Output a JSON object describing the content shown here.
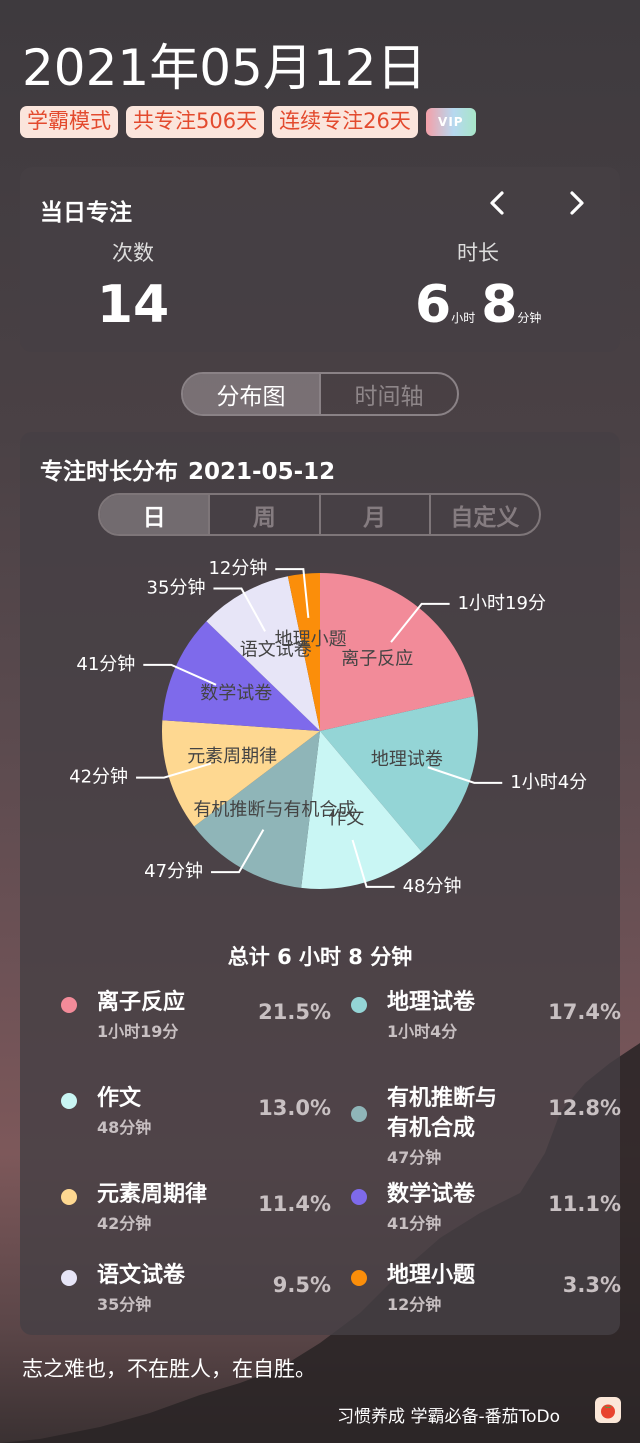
{
  "date_title": "2021年05月12日",
  "badges": [
    "学霸模式",
    "共专注506天",
    "连续专注26天"
  ],
  "vip_label": "VIP",
  "day_card": {
    "title": "当日专注",
    "count_label": "次数",
    "count_value": "14",
    "duration_label": "时长",
    "duration_hours": "6",
    "hours_unit": "小时",
    "duration_minutes": "8",
    "minutes_unit": "分钟"
  },
  "view_tabs": [
    "分布图",
    "时间轴"
  ],
  "distribution": {
    "title": "专注时长分布",
    "date": "2021-05-12",
    "range_tabs": [
      "日",
      "周",
      "月",
      "自定义"
    ],
    "total": "总计 6 小时 8 分钟"
  },
  "chart_data": {
    "type": "pie",
    "title": "专注时长分布",
    "unit": "minutes",
    "slices": [
      {
        "label": "离子反应",
        "value": 79,
        "duration_label": "1小时19分",
        "legend_duration": "1小时19分",
        "percent": "21.5%",
        "color": "#f28b99"
      },
      {
        "label": "地理试卷",
        "value": 64,
        "duration_label": "1小时4分",
        "legend_duration": "1小时4分",
        "percent": "17.4%",
        "color": "#94d5d6"
      },
      {
        "label": "作文",
        "value": 48,
        "duration_label": "48分钟",
        "legend_duration": "48分钟",
        "percent": "13.0%",
        "color": "#c9f6f4"
      },
      {
        "label": "有机推断与有机合成",
        "legend_label": "有机推断与\n有机合成",
        "value": 47,
        "duration_label": "47分钟",
        "legend_duration": "47分钟",
        "percent": "12.8%",
        "color": "#8fb5b8"
      },
      {
        "label": "元素周期律",
        "value": 42,
        "duration_label": "42分钟",
        "legend_duration": "42分钟",
        "percent": "11.4%",
        "color": "#fed891"
      },
      {
        "label": "数学试卷",
        "value": 41,
        "duration_label": "41分钟",
        "legend_duration": "41分钟",
        "percent": "11.1%",
        "color": "#7e6aeb"
      },
      {
        "label": "语文试卷",
        "value": 35,
        "duration_label": "35分钟",
        "legend_duration": "35分钟",
        "percent": "9.5%",
        "color": "#e7e5f7"
      },
      {
        "label": "地理小题",
        "value": 12,
        "duration_label": "12分钟",
        "legend_duration": "12分钟",
        "percent": "3.3%",
        "color": "#fb8e0a"
      }
    ]
  },
  "quote": "志之难也，不在胜人，在自胜。",
  "footer": "习惯养成 学霸必备-番茄ToDo",
  "icons": {
    "prev": "chevron-left-icon",
    "next": "chevron-right-icon",
    "app": "tomato-icon"
  }
}
